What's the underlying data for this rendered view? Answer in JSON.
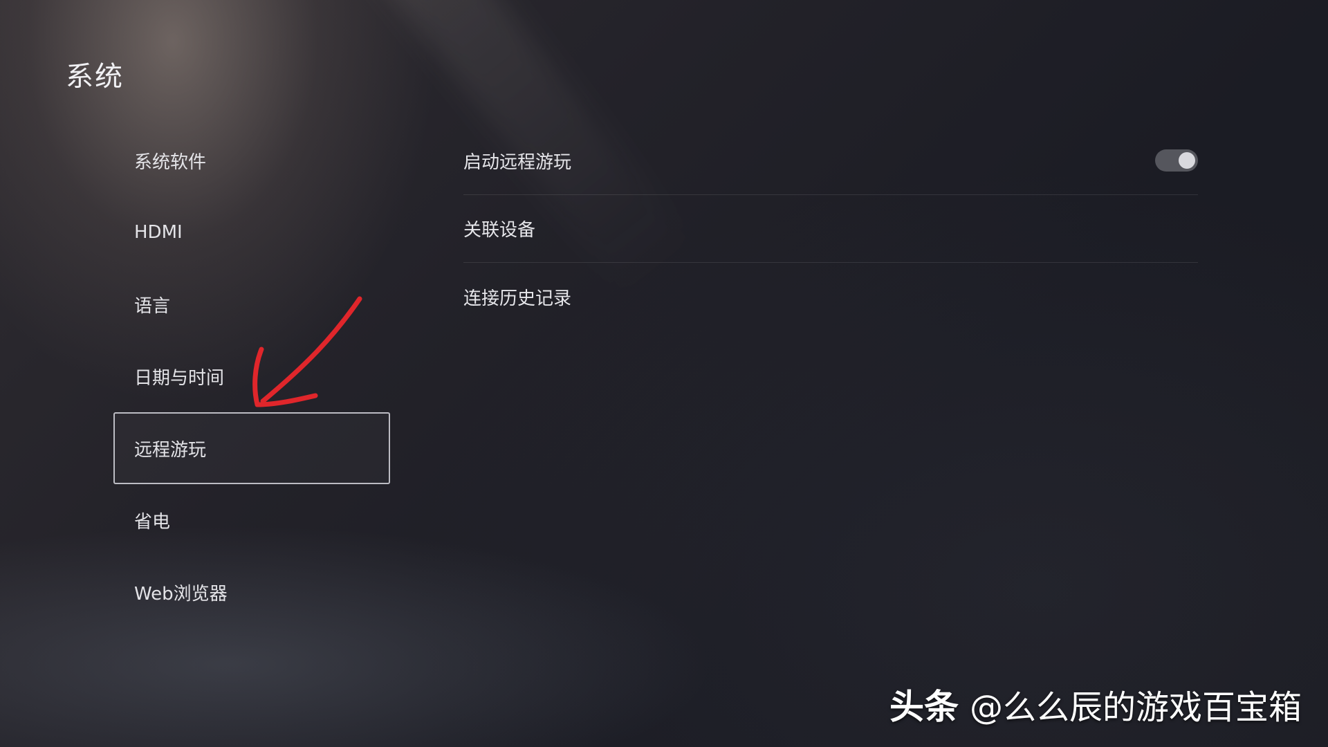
{
  "header": {
    "title": "系统"
  },
  "sidebar": {
    "items": [
      {
        "label": "系统软件"
      },
      {
        "label": "HDMI"
      },
      {
        "label": "语言"
      },
      {
        "label": "日期与时间"
      },
      {
        "label": "远程游玩",
        "selected": true
      },
      {
        "label": "省电"
      },
      {
        "label": "Web浏览器"
      }
    ]
  },
  "content": {
    "rows": [
      {
        "label": "启动远程游玩",
        "control": "toggle",
        "toggle_on": true
      },
      {
        "label": "关联设备"
      },
      {
        "label": "连接历史记录"
      }
    ]
  },
  "watermark": {
    "brand": "头条",
    "handle": "@么么辰的游戏百宝箱"
  },
  "colors": {
    "annotation_arrow": "#e0262b",
    "selection_border": "#d7d7de",
    "toggle_track": "#55565d",
    "toggle_knob": "#d9d9de"
  },
  "icons": {
    "annotation": "red-arrow-icon"
  }
}
